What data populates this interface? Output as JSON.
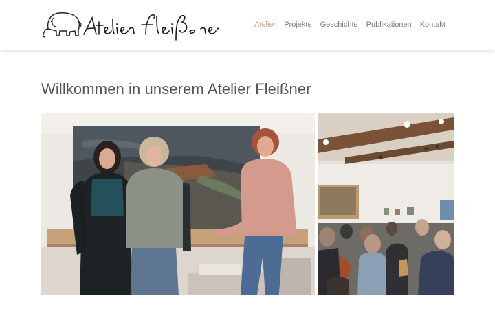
{
  "header": {
    "logo_alt": "Atelier Fleißner",
    "nav": [
      {
        "label": "Atelier",
        "active": true
      },
      {
        "label": "Projekte",
        "active": false
      },
      {
        "label": "Geschichte",
        "active": false
      },
      {
        "label": "Publikationen",
        "active": false
      },
      {
        "label": "Kontakt",
        "active": false
      }
    ]
  },
  "main": {
    "title": "Willkommen in unserem Atelier Fleißner"
  },
  "gallery": {
    "photos": [
      {
        "alt": ""
      },
      {
        "alt": ""
      }
    ]
  },
  "colors": {
    "nav_active": "#c79f85",
    "nav_text": "#7a7a7a",
    "title_text": "#555555"
  }
}
